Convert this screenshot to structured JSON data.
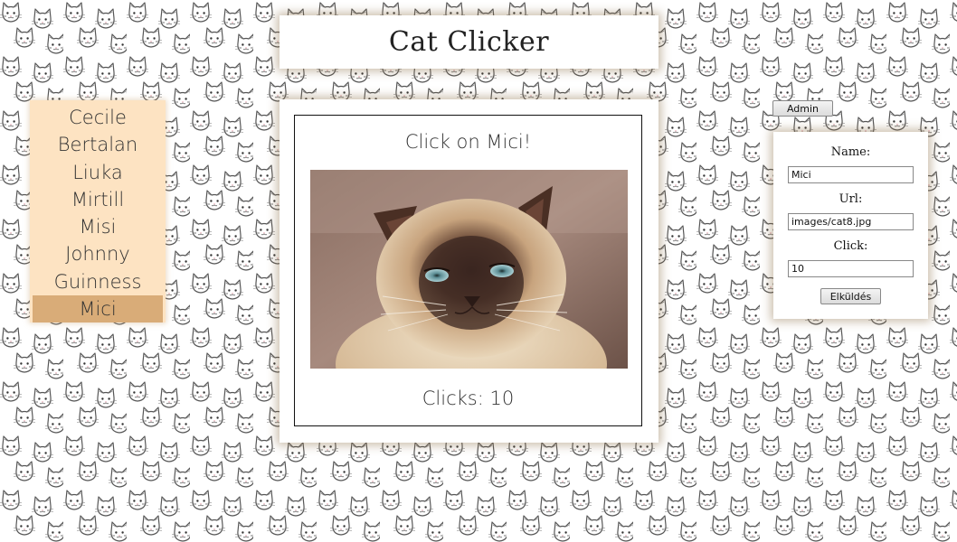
{
  "app": {
    "title": "Cat Clicker"
  },
  "cat_list": {
    "items": [
      "Cecile",
      "Bertalan",
      "Liuka",
      "Mirtill",
      "Misi",
      "Johnny",
      "Guinness",
      "Mici"
    ],
    "selected": "Mici"
  },
  "main": {
    "prompt": "Click on Mici!",
    "clicks_text": "Clicks: 10",
    "image_icon": "siamese-cat-photo"
  },
  "admin": {
    "button_label": "Admin",
    "name_label": "Name:",
    "name_value": "Mici",
    "url_label": "Url:",
    "url_value": "images/cat8.jpg",
    "click_label": "Click:",
    "click_value": "10",
    "submit_label": "Elküldés"
  },
  "colors": {
    "list_background": "#fde3c2",
    "list_selected": "#d9ac78",
    "panel_shadow": "#8c6e46",
    "background_icon": "cat-face-icon"
  }
}
